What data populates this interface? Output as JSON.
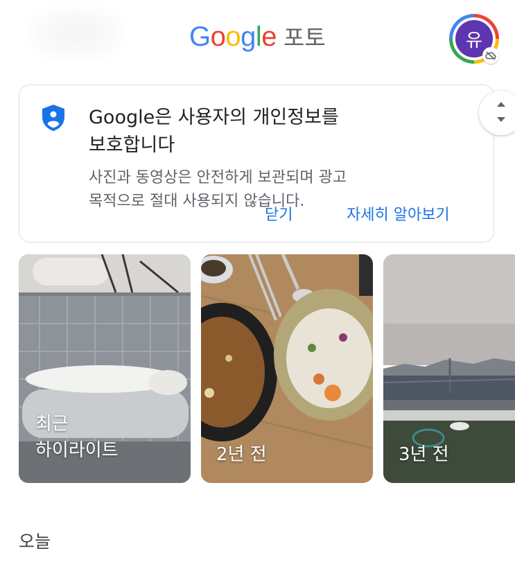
{
  "header": {
    "logo_letters": [
      {
        "ch": "G",
        "color": "#4285f4"
      },
      {
        "ch": "o",
        "color": "#ea4335"
      },
      {
        "ch": "o",
        "color": "#fbbc05"
      },
      {
        "ch": "g",
        "color": "#4285f4"
      },
      {
        "ch": "l",
        "color": "#34a853"
      },
      {
        "ch": "e",
        "color": "#ea4335"
      }
    ],
    "logo_suffix": "포토",
    "avatar_initial": "유",
    "avatar_color": "#5e35b1"
  },
  "privacy_card": {
    "title": "Google은 사용자의 개인정보를\n보호합니다",
    "body": "사진과 동영상은 안전하게 보관되며 광고\n목적으로 절대 사용되지 않습니다.",
    "close_label": "닫기",
    "learn_more_label": "자세히 알아보기",
    "accent_color": "#1a73e8"
  },
  "memories": [
    {
      "label": "최근\n하이라이트"
    },
    {
      "label": "2년 전"
    },
    {
      "label": "3년 전"
    }
  ],
  "section": {
    "title": "오늘"
  }
}
